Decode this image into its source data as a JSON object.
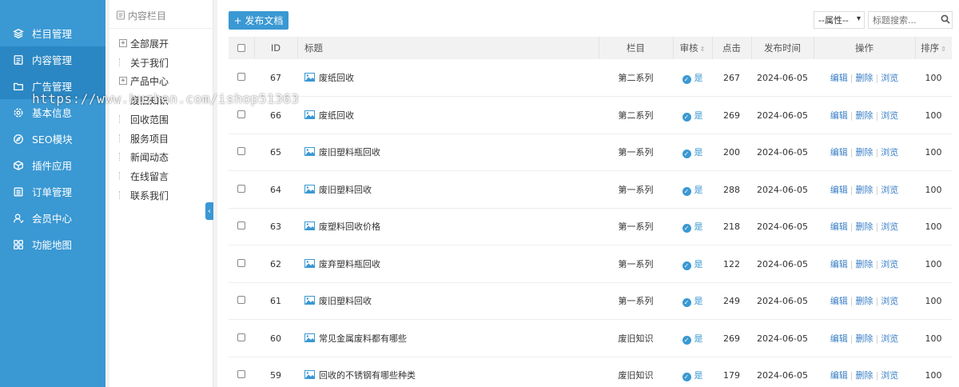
{
  "sidebar": {
    "items": [
      {
        "label": "栏目管理",
        "icon": "layers-icon"
      },
      {
        "label": "内容管理",
        "icon": "document-icon"
      },
      {
        "label": "广告管理",
        "icon": "folder-icon"
      },
      {
        "label": "基本信息",
        "icon": "gear-icon"
      },
      {
        "label": "SEO模块",
        "icon": "compass-icon"
      },
      {
        "label": "插件应用",
        "icon": "cube-icon"
      },
      {
        "label": "订单管理",
        "icon": "list-icon"
      },
      {
        "label": "会员中心",
        "icon": "user-icon"
      },
      {
        "label": "功能地图",
        "icon": "grid-icon"
      }
    ]
  },
  "tree": {
    "header": "内容栏目",
    "nodes": [
      {
        "label": "全部展开",
        "expander": "+"
      },
      {
        "label": "关于我们",
        "expander": ""
      },
      {
        "label": "产品中心",
        "expander": "+"
      },
      {
        "label": "废旧知识",
        "expander": ""
      },
      {
        "label": "回收范围",
        "expander": ""
      },
      {
        "label": "服务项目",
        "expander": ""
      },
      {
        "label": "新闻动态",
        "expander": ""
      },
      {
        "label": "在线留言",
        "expander": ""
      },
      {
        "label": "联系我们",
        "expander": ""
      }
    ]
  },
  "toolbar": {
    "publish_label": "+ 发布文档",
    "attr_select": "--属性--",
    "search_placeholder": "标题搜索..."
  },
  "table": {
    "headers": {
      "id": "ID",
      "title": "标题",
      "column": "栏目",
      "audit": "审核",
      "clicks": "点击",
      "time": "发布时间",
      "ops": "操作",
      "order": "排序"
    },
    "ops": {
      "edit": "编辑",
      "delete": "删除",
      "view": "浏览",
      "sep": "|"
    },
    "rows": [
      {
        "id": "67",
        "title": "废纸回收",
        "column": "第二系列",
        "audit": "是",
        "clicks": "267",
        "time": "2024-06-05",
        "order": "100"
      },
      {
        "id": "66",
        "title": "废纸回收",
        "column": "第二系列",
        "audit": "是",
        "clicks": "269",
        "time": "2024-06-05",
        "order": "100"
      },
      {
        "id": "65",
        "title": "废旧塑料瓶回收",
        "column": "第一系列",
        "audit": "是",
        "clicks": "200",
        "time": "2024-06-05",
        "order": "100"
      },
      {
        "id": "64",
        "title": "废旧塑料回收",
        "column": "第一系列",
        "audit": "是",
        "clicks": "288",
        "time": "2024-06-05",
        "order": "100"
      },
      {
        "id": "63",
        "title": "废塑料回收价格",
        "column": "第一系列",
        "audit": "是",
        "clicks": "218",
        "time": "2024-06-05",
        "order": "100"
      },
      {
        "id": "62",
        "title": "废弃塑料瓶回收",
        "column": "第一系列",
        "audit": "是",
        "clicks": "122",
        "time": "2024-06-05",
        "order": "100"
      },
      {
        "id": "61",
        "title": "废旧塑料回收",
        "column": "第一系列",
        "audit": "是",
        "clicks": "249",
        "time": "2024-06-05",
        "order": "100"
      },
      {
        "id": "60",
        "title": "常见金属废料都有哪些",
        "column": "废旧知识",
        "audit": "是",
        "clicks": "269",
        "time": "2024-06-05",
        "order": "100"
      },
      {
        "id": "59",
        "title": "回收的不锈钢有哪些种类",
        "column": "废旧知识",
        "audit": "是",
        "clicks": "179",
        "time": "2024-06-05",
        "order": "100"
      }
    ]
  },
  "watermark": "https://www.huzhan.com/ishop51363",
  "colors": {
    "accent": "#3a98d3",
    "link": "#3a7fc6"
  }
}
